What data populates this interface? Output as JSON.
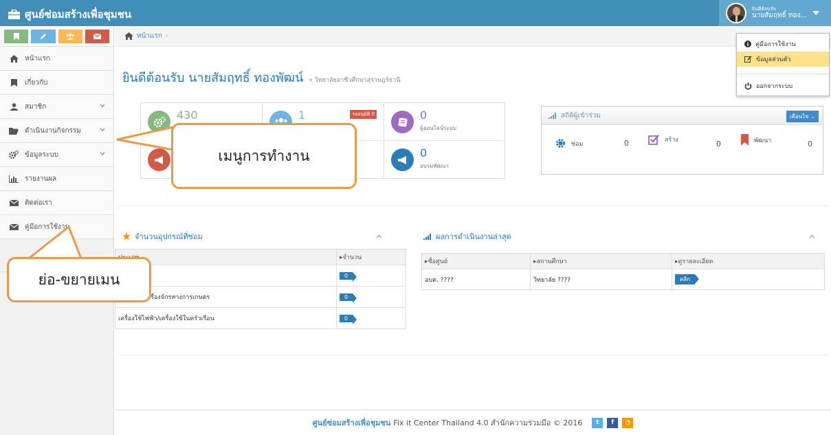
{
  "app": {
    "title": "ศูนย์ซ่อมสร้างเพื่อชุมชน"
  },
  "user": {
    "welcome": "ยินดีต้อนรับ",
    "name": "นายสัมฤทธิ์ ทอง..."
  },
  "dropdown": {
    "items": [
      {
        "label": "คู่มือการใช้งาน",
        "icon": "info-icon"
      },
      {
        "label": "ข้อมูลส่วนตัว",
        "icon": "edit-icon",
        "highlighted": true
      },
      {
        "label": "ออกจากระบบ",
        "icon": "power-icon"
      }
    ]
  },
  "shortcuts": [
    {
      "name": "bookmark-icon",
      "color": "#87b87f"
    },
    {
      "name": "pencil-icon",
      "color": "#6fb3e0"
    },
    {
      "name": "users-icon",
      "color": "#ffb752"
    },
    {
      "name": "envelope-icon",
      "color": "#d15b47"
    }
  ],
  "sidebar": {
    "items": [
      {
        "label": "หน้าแรก",
        "icon": "home-icon",
        "has_sub": false
      },
      {
        "label": "เกี่ยวกับ",
        "icon": "bookmark-icon",
        "has_sub": false
      },
      {
        "label": "สมาชิก",
        "icon": "user-icon",
        "has_sub": true
      },
      {
        "label": "ดำเนินงานกิจกรรม",
        "icon": "folder-icon",
        "has_sub": true
      },
      {
        "label": "ข้อมูลระบบ",
        "icon": "cogs-icon",
        "has_sub": true
      },
      {
        "label": "รายงานผล",
        "icon": "bar-chart-icon",
        "has_sub": false
      },
      {
        "label": "ติดต่อเรา",
        "icon": "envelope-icon",
        "has_sub": false
      },
      {
        "label": "คู่มือการใช้งาน",
        "icon": "envelope-icon",
        "has_sub": false
      }
    ]
  },
  "breadcrumb": {
    "home": "หน้าแรก"
  },
  "welcome": {
    "title": "ยินดีต้อนรับ นายสัมฤทธิ์ ทองพัฒน์",
    "subtitle": "» วิทยาลัยอาชีวศึกษาสุราษฎร์ธานี"
  },
  "stats": {
    "repair_count": "430",
    "members_count": "1",
    "pending_label": "รออนุมัติ 0",
    "online_count": "0",
    "online_label": "ผู้ออนไลน์ระบบ",
    "training_count": "0",
    "training_label": "อบรมพัฒนา"
  },
  "participants": {
    "title": "สถิติผู้เข้าร่วม",
    "month_button": "เดือนไข",
    "items": [
      {
        "label": "ซ่อม",
        "value": "0",
        "icon": "cog-icon"
      },
      {
        "label": "สร้าง",
        "value": "0",
        "icon": "check-square-icon"
      },
      {
        "label": "พัฒนา",
        "value": "0",
        "icon": "bookmark-icon"
      }
    ]
  },
  "equipment": {
    "title": "จำนวนอุปกรณ์ที่ซ่อม",
    "col_type": "ประเภท",
    "col_count": "จำนวน",
    "rows": [
      {
        "name": "ยานพาหนะ",
        "count": "0"
      },
      {
        "name": "เครื่องมือ/เครื่องจักรทางการเกษตร",
        "count": "0"
      },
      {
        "name": "เครื่องใช้ไฟฟ้า/เครื่องใช้ในครัวเรือน",
        "count": "0"
      }
    ]
  },
  "results": {
    "title": "ผลการดำเนินงานล่าสุด",
    "col_center": "ชื่อศูนย์",
    "col_school": "สถานศึกษา",
    "col_detail": "ดูรายละเอียด",
    "rows": [
      {
        "center": "อบต. ????",
        "school": "วิทยาลัย ????",
        "action": "คลิก"
      }
    ]
  },
  "footer": {
    "brand": "ศูนย์ซ่อมสร้างเพื่อชุมชน",
    "text": "Fix it Center Thailand 4.0 สำนักความร่วมมือ © 2016"
  },
  "annotations": {
    "menu": "เมนูการทำงาน",
    "toggle": "ย่อ-ขยายเมน"
  }
}
